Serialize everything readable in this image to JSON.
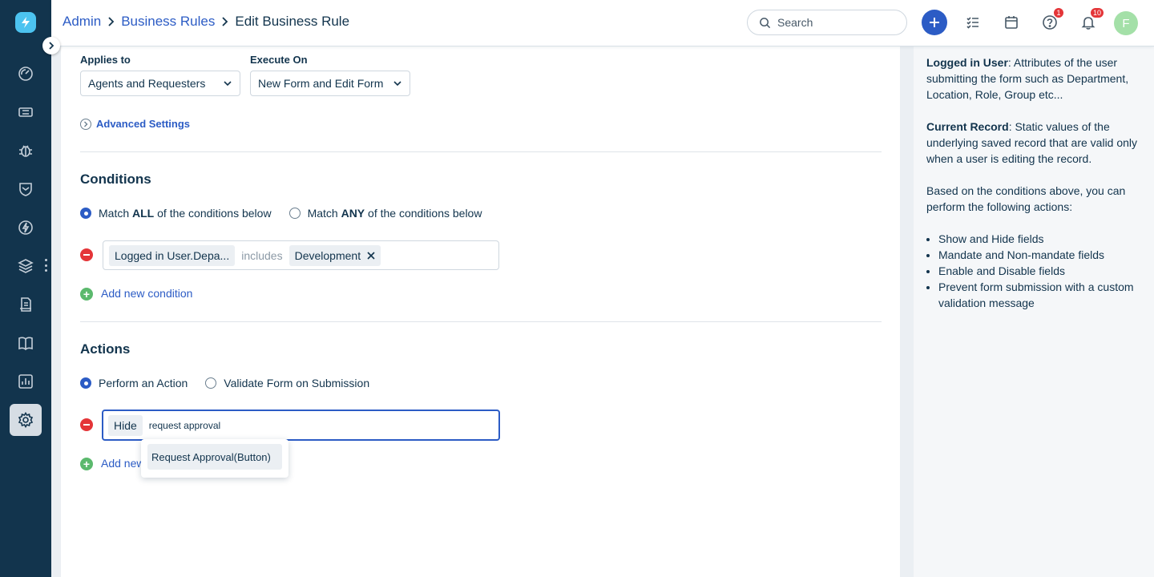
{
  "header": {
    "breadcrumb": [
      "Admin",
      "Business Rules"
    ],
    "current_page": "Edit Business Rule",
    "search_placeholder": "Search",
    "help_badge": "1",
    "notification_badge": "10",
    "avatar_initial": "F"
  },
  "settings": {
    "applies_to_label": "Applies to",
    "applies_to_value": "Agents and Requesters",
    "execute_on_label": "Execute On",
    "execute_on_value": "New Form and Edit Form",
    "advanced_label": "Advanced Settings"
  },
  "conditions": {
    "title": "Conditions",
    "match_all_pre": "Match",
    "match_all_key": "ALL",
    "match_all_post": "of the conditions below",
    "match_any_pre": "Match",
    "match_any_key": "ANY",
    "match_any_post": "of the conditions below",
    "selected_mode": "ALL",
    "condition_field": "Logged in User.Depa...",
    "condition_operator": "includes",
    "condition_value": "Development",
    "add_label": "Add new condition"
  },
  "actions": {
    "title": "Actions",
    "perform_label": "Perform an Action",
    "validate_label": "Validate Form on Submission",
    "selected_mode": "Perform an Action",
    "action_type": "Hide",
    "search_text": "request approval",
    "suggestion": "Request Approval(Button)",
    "add_label": "Add new"
  },
  "help_panel": {
    "logged_in_title": "Logged in User",
    "logged_in_text": ": Attributes of the user submitting the form such as Department, Location, Role, Group etc...",
    "current_record_title": "Current Record",
    "current_record_text": ": Static values of the underlying saved record that are valid only when a user is editing the record.",
    "intro": "Based on the conditions above, you can perform the following actions:",
    "bullets": [
      "Show and Hide fields",
      "Mandate and Non-mandate fields",
      "Enable and Disable fields",
      "Prevent form submission with a custom validation message"
    ]
  },
  "colors": {
    "sidebar": "#12344d",
    "accent": "#2c5cc5",
    "danger": "#e43538",
    "success": "#5bb96d"
  }
}
